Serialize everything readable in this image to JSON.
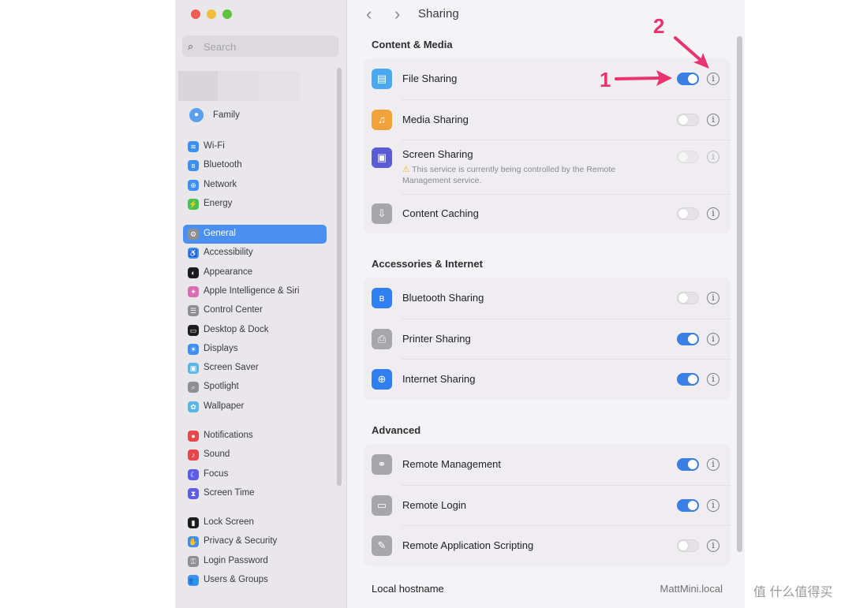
{
  "sidebar": {
    "search_placeholder": "Search",
    "family_label": "Family",
    "groups": [
      [
        {
          "label": "Wi-Fi",
          "icon": "wifi-icon",
          "glyph": "≋",
          "color": "#3d8ff0"
        },
        {
          "label": "Bluetooth",
          "icon": "bluetooth-icon",
          "glyph": "ʙ",
          "color": "#3d8ff0"
        },
        {
          "label": "Network",
          "icon": "network-icon",
          "glyph": "⊕",
          "color": "#3d8ff0"
        },
        {
          "label": "Energy",
          "icon": "energy-icon",
          "glyph": "⚡",
          "color": "#45c24f"
        }
      ],
      [
        {
          "label": "General",
          "icon": "gear-icon",
          "glyph": "⚙",
          "color": "#8e8e93",
          "active": true
        },
        {
          "label": "Accessibility",
          "icon": "accessibility-icon",
          "glyph": "♿",
          "color": "#3d8ff0"
        },
        {
          "label": "Appearance",
          "icon": "appearance-icon",
          "glyph": "◐",
          "color": "#1c1c1e"
        },
        {
          "label": "Apple Intelligence & Siri",
          "icon": "siri-icon",
          "glyph": "✦",
          "color": "#d86fb5"
        },
        {
          "label": "Control Center",
          "icon": "control-center-icon",
          "glyph": "☰",
          "color": "#8e8e93"
        },
        {
          "label": "Desktop & Dock",
          "icon": "dock-icon",
          "glyph": "▭",
          "color": "#1c1c1e"
        },
        {
          "label": "Displays",
          "icon": "displays-icon",
          "glyph": "☀",
          "color": "#3d8ff0"
        },
        {
          "label": "Screen Saver",
          "icon": "screen-saver-icon",
          "glyph": "▣",
          "color": "#5ab6e8"
        },
        {
          "label": "Spotlight",
          "icon": "spotlight-icon",
          "glyph": "⌕",
          "color": "#8e8e93"
        },
        {
          "label": "Wallpaper",
          "icon": "wallpaper-icon",
          "glyph": "✿",
          "color": "#5ab6e8"
        }
      ],
      [
        {
          "label": "Notifications",
          "icon": "notifications-icon",
          "glyph": "●",
          "color": "#e8474a"
        },
        {
          "label": "Sound",
          "icon": "sound-icon",
          "glyph": "♪",
          "color": "#e8474a"
        },
        {
          "label": "Focus",
          "icon": "focus-icon",
          "glyph": "☾",
          "color": "#5e5ce6"
        },
        {
          "label": "Screen Time",
          "icon": "screen-time-icon",
          "glyph": "⧗",
          "color": "#5e5ce6"
        }
      ],
      [
        {
          "label": "Lock Screen",
          "icon": "lock-screen-icon",
          "glyph": "▮",
          "color": "#1c1c1e"
        },
        {
          "label": "Privacy & Security",
          "icon": "privacy-icon",
          "glyph": "✋",
          "color": "#3d8ff0"
        },
        {
          "label": "Login Password",
          "icon": "login-password-icon",
          "glyph": "⚿",
          "color": "#8e8e93"
        },
        {
          "label": "Users & Groups",
          "icon": "users-icon",
          "glyph": "👥",
          "color": "#3d8ff0"
        }
      ]
    ]
  },
  "header": {
    "title": "Sharing"
  },
  "sections": [
    {
      "heading": "Content & Media",
      "rows": [
        {
          "label": "File Sharing",
          "icon": "folder-icon",
          "glyph": "▤",
          "color": "#4aa8f0",
          "enabled": true
        },
        {
          "label": "Media Sharing",
          "icon": "media-icon",
          "glyph": "♫",
          "color": "#f2a23a",
          "enabled": false
        },
        {
          "label": "Screen Sharing",
          "icon": "screen-sharing-icon",
          "glyph": "▣",
          "color": "#5b5bd6",
          "enabled": false,
          "disabled": true,
          "warning": "This service is currently being controlled by the Remote Management service."
        },
        {
          "label": "Content Caching",
          "icon": "content-caching-icon",
          "glyph": "⇩",
          "color": "#a7a6aa",
          "enabled": false
        }
      ]
    },
    {
      "heading": "Accessories & Internet",
      "rows": [
        {
          "label": "Bluetooth Sharing",
          "icon": "bluetooth-icon",
          "glyph": "ʙ",
          "color": "#2f7ff0",
          "enabled": false
        },
        {
          "label": "Printer Sharing",
          "icon": "printer-icon",
          "glyph": "⎙",
          "color": "#a7a6aa",
          "enabled": true
        },
        {
          "label": "Internet Sharing",
          "icon": "globe-icon",
          "glyph": "⊕",
          "color": "#2f7ff0",
          "enabled": true
        }
      ]
    },
    {
      "heading": "Advanced",
      "rows": [
        {
          "label": "Remote Management",
          "icon": "binoculars-icon",
          "glyph": "⚭",
          "color": "#a7a6aa",
          "enabled": true
        },
        {
          "label": "Remote Login",
          "icon": "terminal-icon",
          "glyph": "▭",
          "color": "#a7a6aa",
          "enabled": true
        },
        {
          "label": "Remote Application Scripting",
          "icon": "script-icon",
          "glyph": "✎",
          "color": "#a7a6aa",
          "enabled": false
        }
      ]
    }
  ],
  "hostname": {
    "label": "Local hostname",
    "value": "MattMini.local"
  },
  "annotations": {
    "one": "1",
    "two": "2",
    "color": "#e8336f"
  },
  "watermark": "值 什么值得买"
}
